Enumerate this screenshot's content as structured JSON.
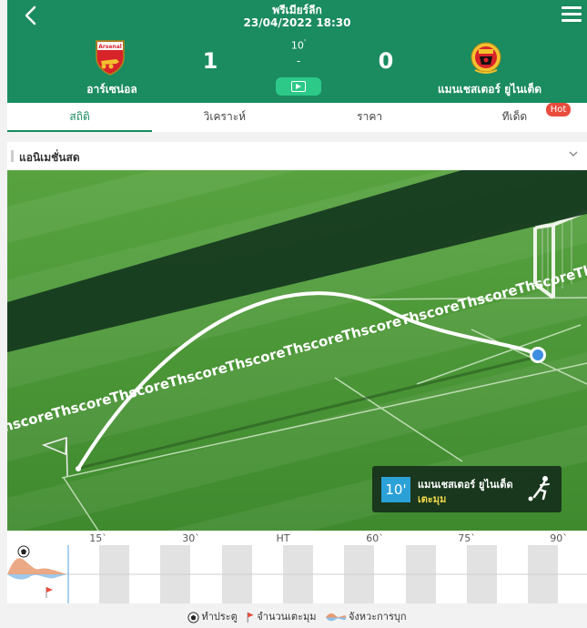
{
  "header": {
    "league": "พรีเมียร์ลีก",
    "datetime": "23/04/2022 18:30",
    "home_team": "อาร์เซน่อล",
    "away_team": "แมนเชสเตอร์ ยูไนเต็ด",
    "home_score": "1",
    "away_score": "0",
    "minute": "10",
    "minute_mark": "'",
    "separator": "-",
    "home_crest_text": "Arsenal"
  },
  "tabs": [
    {
      "label": "สถิติ",
      "active": true
    },
    {
      "label": "วิเคราะห์",
      "active": false
    },
    {
      "label": "ราคา",
      "active": false
    },
    {
      "label": "ทีเด็ด",
      "active": false,
      "badge": "Hot"
    }
  ],
  "section": {
    "title": "แอนิเมชั่นสด"
  },
  "pitch": {
    "watermark": "Thscore"
  },
  "event": {
    "minute": "10'",
    "team": "แมนเชสเตอร์ ยูไนเต็ด",
    "type": "เตะมุม"
  },
  "timeline": {
    "labels": [
      "15`",
      "30`",
      "HT",
      "60`",
      "75`",
      "90`"
    ]
  },
  "legend": {
    "goal": "ทำประตู",
    "corner": "จำนวนเตะมุม",
    "attack": "จังหวะการบุก"
  },
  "colors": {
    "header_green": "#1b8b60",
    "video_button": "#2cc989",
    "hot_badge": "#e94c3d",
    "event_minute": "#2ba1d8",
    "event_type": "#f0d64a"
  }
}
